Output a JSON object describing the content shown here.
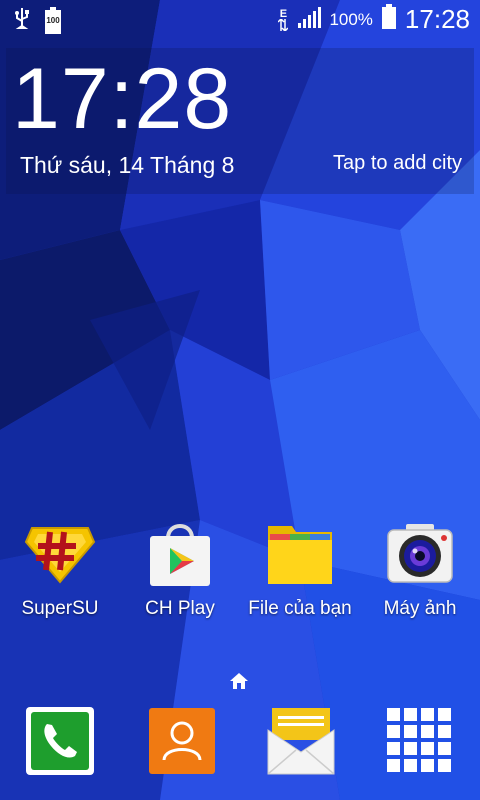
{
  "status_bar": {
    "left_icons": [
      "usb-icon",
      "battery-100-notification-icon"
    ],
    "battery_notice": "100",
    "network_type": "E",
    "battery_percent": "100%",
    "time": "17:28"
  },
  "clock_widget": {
    "time": "17:28",
    "date": "Thứ sáu, 14 Tháng 8",
    "weather_prompt": "Tap to add city"
  },
  "apps": [
    {
      "label": "SuperSU",
      "icon": "supersu-icon"
    },
    {
      "label": "CH Play",
      "icon": "play-store-icon"
    },
    {
      "label": "File của bạn",
      "icon": "folder-icon"
    },
    {
      "label": "Máy ảnh",
      "icon": "camera-icon"
    }
  ],
  "home_indicator": "home-icon",
  "dock": [
    {
      "name": "phone",
      "icon": "phone-icon",
      "color": "#1e9e2d"
    },
    {
      "name": "contacts",
      "icon": "contacts-icon",
      "color": "#f07a12"
    },
    {
      "name": "messages",
      "icon": "messages-icon",
      "color": "#f3c518"
    },
    {
      "name": "apps",
      "icon": "app-grid-icon",
      "color": "#ffffff"
    }
  ],
  "colors": {
    "wallpaper_base": "#1b34c9",
    "wallpaper_dark": "#0a1560",
    "wallpaper_light": "#3a6cf5"
  }
}
